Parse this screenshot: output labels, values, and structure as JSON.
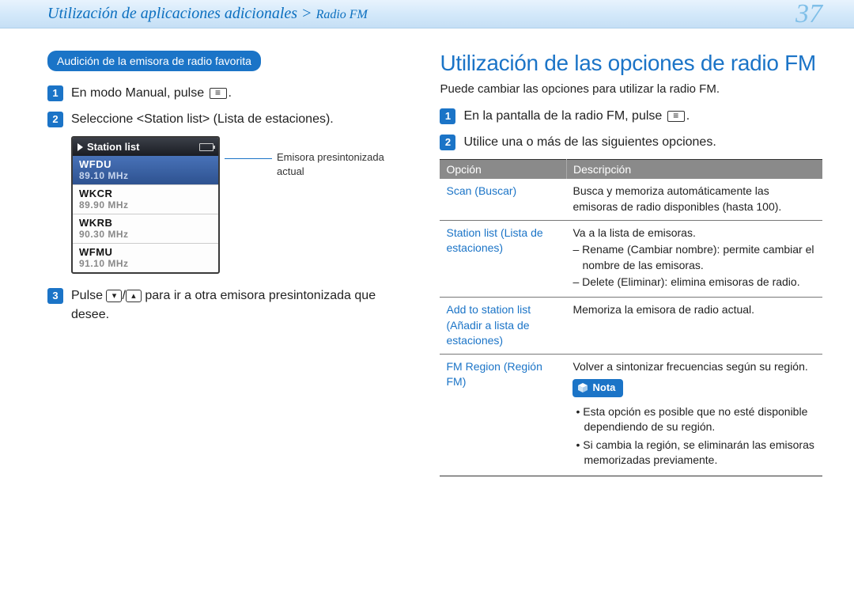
{
  "header": {
    "breadcrumb_main": "Utilización de aplicaciones adicionales > ",
    "breadcrumb_sub": "Radio FM",
    "page_number": "37"
  },
  "left": {
    "pill_label": "Audición de la emisora de radio favorita",
    "step1_before": "En modo Manual, pulse ",
    "step1_after": ".",
    "step2": "Seleccione <Station list> (Lista de estaciones).",
    "station_list_title": "Station list",
    "stations": [
      {
        "call": "WFDU",
        "freq": "89.10 MHz",
        "active": true
      },
      {
        "call": "WKCR",
        "freq": "89.90 MHz",
        "active": false
      },
      {
        "call": "WKRB",
        "freq": "90.30 MHz",
        "active": false
      },
      {
        "call": "WFMU",
        "freq": "91.10 MHz",
        "active": false
      }
    ],
    "callout": "Emisora presintonizada actual",
    "step3_before": "Pulse ",
    "step3_after": " para ir a otra emisora presintonizada que desee."
  },
  "right": {
    "title": "Utilización de las opciones de radio FM",
    "intro": "Puede cambiar las opciones para utilizar la radio FM.",
    "step1_before": "En la pantalla de la radio FM, pulse ",
    "step1_after": ".",
    "step2": "Utilice una o más de las siguientes opciones.",
    "table": {
      "head_option": "Opción",
      "head_desc": "Descripción",
      "rows": [
        {
          "opt": "Scan (Buscar)",
          "desc_plain": "Busca y memoriza automáticamente las emisoras de radio disponibles (hasta 100)."
        },
        {
          "opt": "Station list (Lista de estaciones)",
          "desc_lead": "Va a la lista de emisoras.",
          "desc_items": [
            "– Rename (Cambiar nombre): permite cambiar el nombre de las emisoras.",
            "– Delete (Eliminar): elimina emisoras de radio."
          ]
        },
        {
          "opt": "Add to station list (Añadir a lista de estaciones)",
          "desc_plain": "Memoriza la emisora de radio actual."
        },
        {
          "opt": "FM Region (Región FM)",
          "desc_lead": "Volver a sintonizar frecuencias según su región.",
          "nota_label": "Nota",
          "nota_items": [
            "Esta opción es posible que no esté disponible dependiendo de su región.",
            "Si cambia la región, se eliminarán las emisoras memorizadas previamente."
          ]
        }
      ]
    }
  }
}
